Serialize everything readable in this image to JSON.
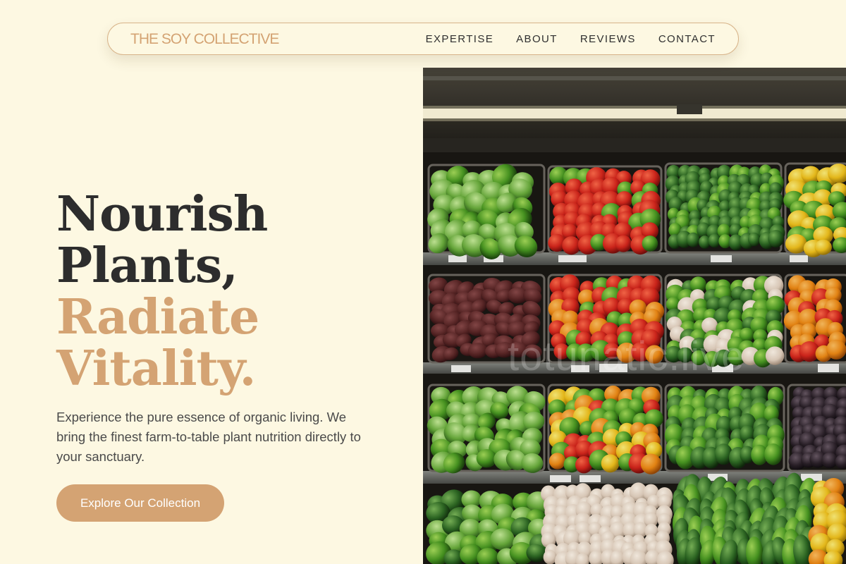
{
  "nav": {
    "brand": "THE SOY COLLECTIVE",
    "links": [
      "EXPERTISE",
      "ABOUT",
      "REVIEWS",
      "CONTACT"
    ]
  },
  "hero": {
    "title_line1": "Nourish",
    "title_line2": "Plants,",
    "title_line3": "Radiate",
    "title_line4": "Vitality.",
    "description": "Experience the pure essence of organic living. We bring the finest farm-to-table plant nutrition directly to your sanctuary.",
    "cta_label": "Explore Our Collection"
  },
  "image": {
    "watermark": "totunatic.live"
  },
  "colors": {
    "background": "#fdf8e2",
    "accent": "#d4a373",
    "text_dark": "#2d2d2d",
    "text_body": "#4a4a4a"
  }
}
